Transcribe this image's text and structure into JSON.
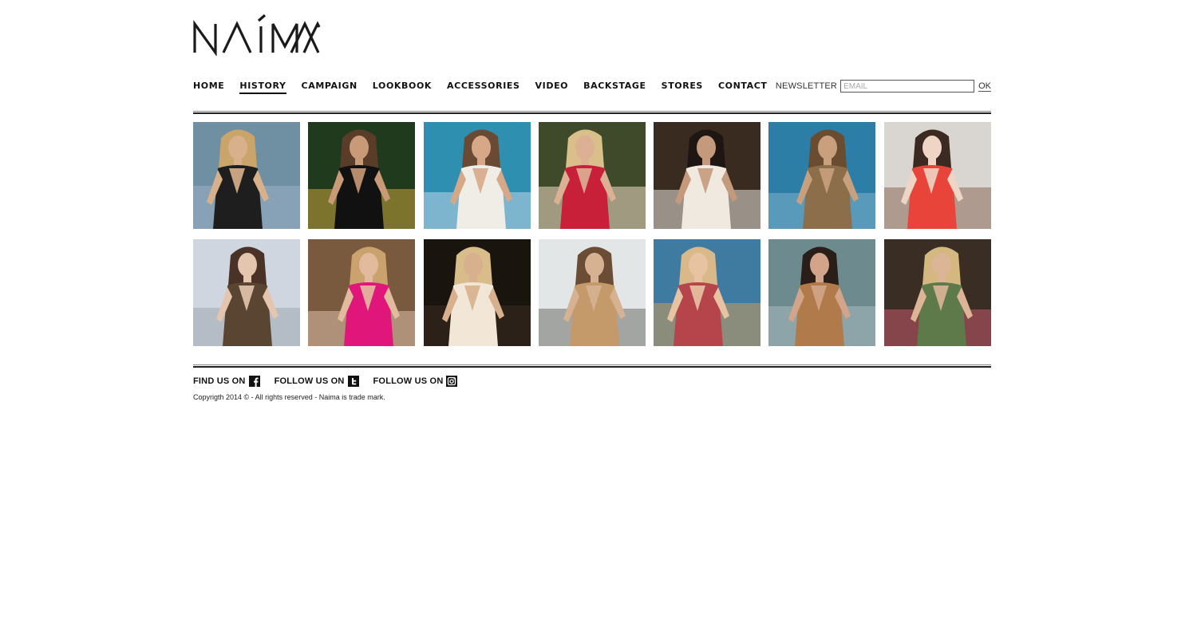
{
  "brand": {
    "logo_text": "NAÍMA"
  },
  "nav": {
    "items": [
      {
        "label": "HOME",
        "active": false
      },
      {
        "label": "HISTORY",
        "active": true
      },
      {
        "label": "CAMPAIGN",
        "active": false
      },
      {
        "label": "LOOKBOOK",
        "active": false
      },
      {
        "label": "ACCESSORIES",
        "active": false
      },
      {
        "label": "VIDEO",
        "active": false
      },
      {
        "label": "BACKSTAGE",
        "active": false
      },
      {
        "label": "STORES",
        "active": false
      },
      {
        "label": "CONTACT",
        "active": false
      }
    ]
  },
  "newsletter": {
    "label": "NEWSLETTER",
    "placeholder": "EMAIL",
    "value": "",
    "submit_label": "OK"
  },
  "gallery": {
    "tiles": [
      {
        "bg": "#6f8fa3",
        "fg": "#1e1e1e",
        "skin": "#d8b08c",
        "hair": "#c9a56a",
        "accent": "#9ab3c9"
      },
      {
        "bg": "#1f3a1c",
        "fg": "#111111",
        "skin": "#c99a78",
        "hair": "#5a3d28",
        "accent": "#c8a23a"
      },
      {
        "bg": "#2f8fb0",
        "fg": "#f0ede6",
        "skin": "#d6a888",
        "hair": "#6b4a33",
        "accent": "#bcd6e6"
      },
      {
        "bg": "#3e4a2a",
        "fg": "#c9203a",
        "skin": "#dcb093",
        "hair": "#d9c08a",
        "accent": "#f0ddc8"
      },
      {
        "bg": "#3a2b20",
        "fg": "#efe9e0",
        "skin": "#c59a7c",
        "hair": "#1d1612",
        "accent": "#e8e4dc"
      },
      {
        "bg": "#2d7ea6",
        "fg": "#8c6e4a",
        "skin": "#c9a07e",
        "hair": "#6a4c30",
        "accent": "#7eaecb"
      },
      {
        "bg": "#d9d5d0",
        "fg": "#e8443a",
        "skin": "#efd5c4",
        "hair": "#3a2a22",
        "accent": "#8b6a5a"
      },
      {
        "bg": "#cfd6e0",
        "fg": "#5a4532",
        "skin": "#e4c5ad",
        "hair": "#4a3326",
        "accent": "#9ea7b0"
      },
      {
        "bg": "#7a5a3e",
        "fg": "#e0167a",
        "skin": "#e2bb9e",
        "hair": "#c9a26e",
        "accent": "#d8c0a8"
      },
      {
        "bg": "#1a140f",
        "fg": "#f2e6d6",
        "skin": "#d7b08e",
        "hair": "#d8bd8a",
        "accent": "#3a2c20"
      },
      {
        "bg": "#e2e6e6",
        "fg": "#c59a6a",
        "skin": "#d6b292",
        "hair": "#6b4c34",
        "accent": "#6f6f6a"
      },
      {
        "bg": "#3f7aa0",
        "fg": "#b5454a",
        "skin": "#e8c3a2",
        "hair": "#d9b98a",
        "accent": "#c89a5e"
      },
      {
        "bg": "#6d8a8e",
        "fg": "#b07a4a",
        "skin": "#d2a58a",
        "hair": "#2a1e18",
        "accent": "#a8bcc0"
      },
      {
        "bg": "#3a2e24",
        "fg": "#5e7a4a",
        "skin": "#dbb596",
        "hair": "#d4b880",
        "accent": "#c25a6a"
      }
    ]
  },
  "footer": {
    "social": [
      {
        "label": "FIND US ON",
        "icon": "facebook-icon"
      },
      {
        "label": "FOLLOW US ON",
        "icon": "twitter-icon"
      },
      {
        "label": "FOLLOW US ON",
        "icon": "instagram-icon"
      }
    ],
    "copyright": "Copyrigth 2014 © - All rights reserved - Naima is trade mark."
  }
}
